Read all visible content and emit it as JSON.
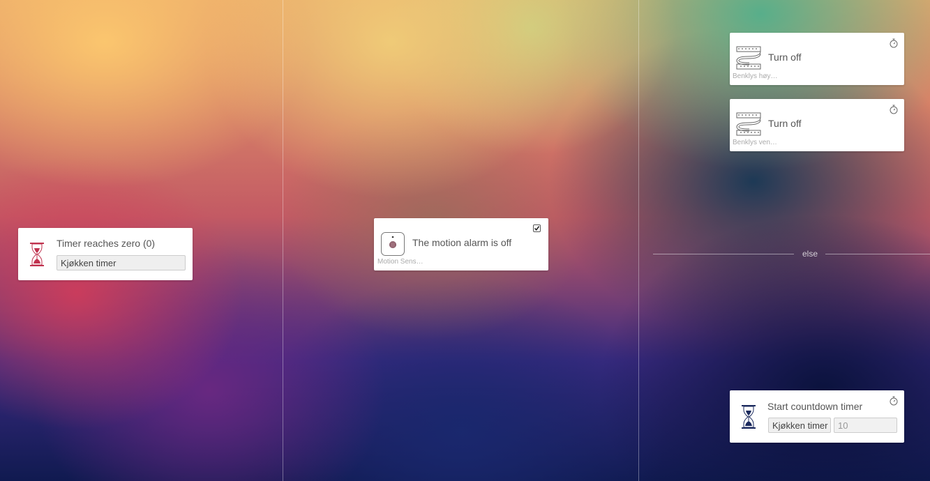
{
  "columns": {
    "when": {
      "trigger_card": {
        "title": "Timer reaches zero (0)",
        "field_value": "Kjøkken timer",
        "icon": "hourglass-icon"
      }
    },
    "and": {
      "condition_card": {
        "title": "The motion alarm is off",
        "device_label": "Motion Sens…",
        "icon": "motion-sensor-icon",
        "checked": true
      }
    },
    "then": {
      "action_cards": [
        {
          "title": "Turn off",
          "device_label": "Benklys høy…",
          "icon": "led-strip-icon"
        },
        {
          "title": "Turn off",
          "device_label": "Benklys ven…",
          "icon": "led-strip-icon"
        }
      ],
      "else_label": "else",
      "else_cards": [
        {
          "title": "Start countdown timer",
          "field_timer": "Kjøkken timer",
          "field_seconds": "10",
          "icon": "hourglass-icon"
        }
      ]
    }
  },
  "colors": {
    "hourglass_red": "#c0334f",
    "hourglass_navy": "#1b2a5e",
    "icon_gray": "#666666"
  }
}
